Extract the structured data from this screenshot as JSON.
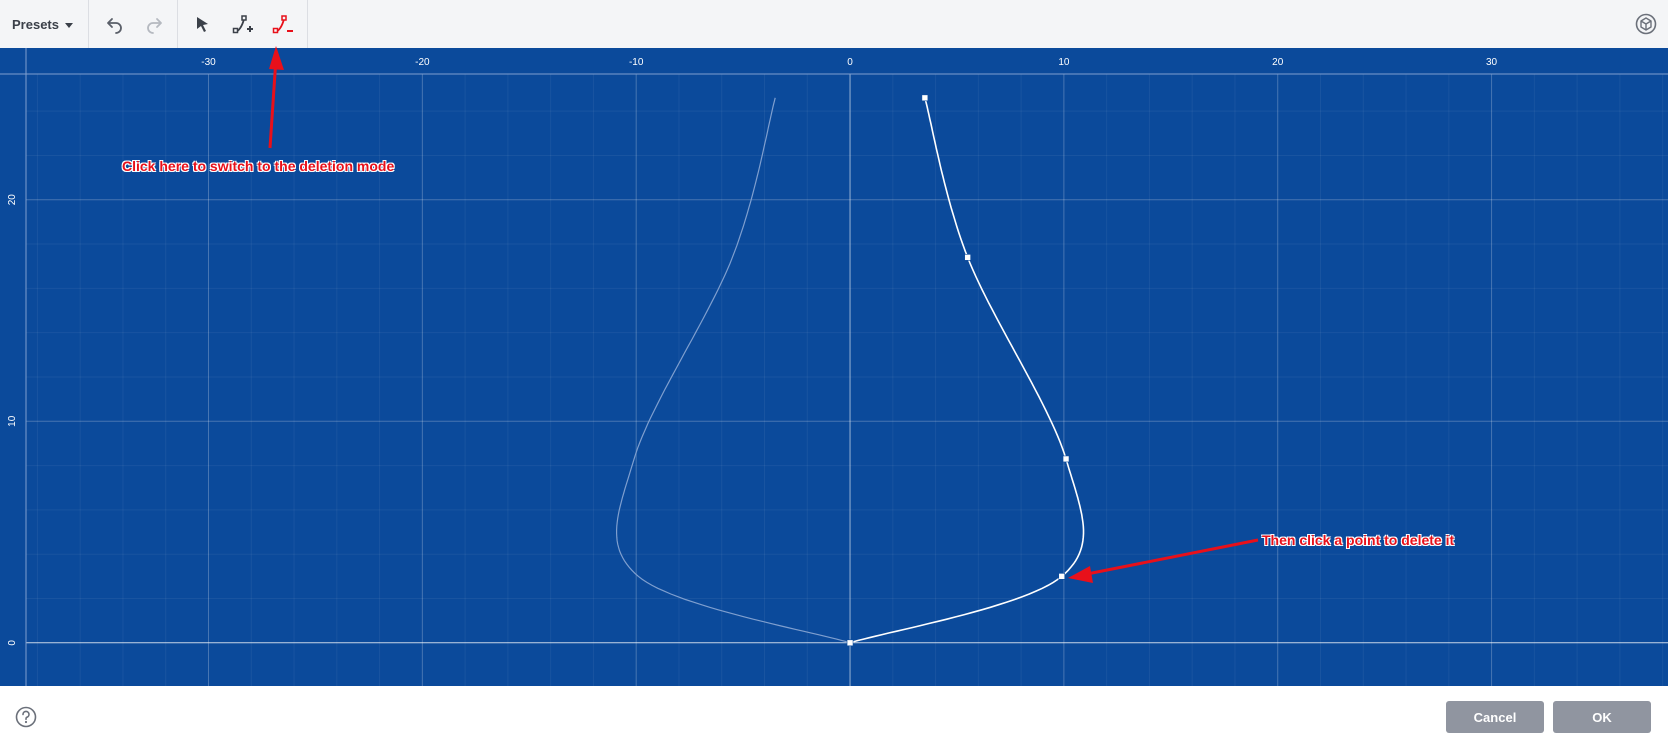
{
  "toolbar": {
    "presets_label": "Presets",
    "tools": [
      {
        "name": "undo",
        "icon": "undo-icon"
      },
      {
        "name": "redo",
        "icon": "redo-icon"
      },
      {
        "name": "select",
        "icon": "cursor-arrow-icon"
      },
      {
        "name": "add-point",
        "icon": "add-point-icon"
      },
      {
        "name": "delete-point",
        "icon": "delete-point-icon",
        "active": true
      }
    ],
    "corner_icon": "scene-view-icon"
  },
  "graph": {
    "background": "#0b4a9b",
    "x_ticks": [
      "-30",
      "-20",
      "-10",
      "0",
      "10",
      "20",
      "30"
    ],
    "x_tick_values": [
      -30,
      -20,
      -10,
      0,
      10,
      20,
      30
    ],
    "y_ticks": [
      "0",
      "10",
      "20"
    ],
    "y_tick_values": [
      0,
      10,
      20
    ],
    "x_range": [
      -39.75,
      38.25
    ],
    "y_range": [
      -1.95,
      26.85
    ],
    "control_points": [
      {
        "x": 0,
        "y": 0
      },
      {
        "x": 9.9,
        "y": 3.0
      },
      {
        "x": 10.1,
        "y": 8.3
      },
      {
        "x": 5.5,
        "y": 17.4
      },
      {
        "x": 3.5,
        "y": 24.6
      }
    ],
    "curve_color": "#ffffff",
    "mirror_color": "#7f9fcf"
  },
  "annotations": {
    "mode_text": "Click here to switch to the deletion mode",
    "delete_text": "Then click a point to delete it",
    "color": "#e8101a"
  },
  "footer": {
    "cancel_label": "Cancel",
    "ok_label": "OK"
  }
}
